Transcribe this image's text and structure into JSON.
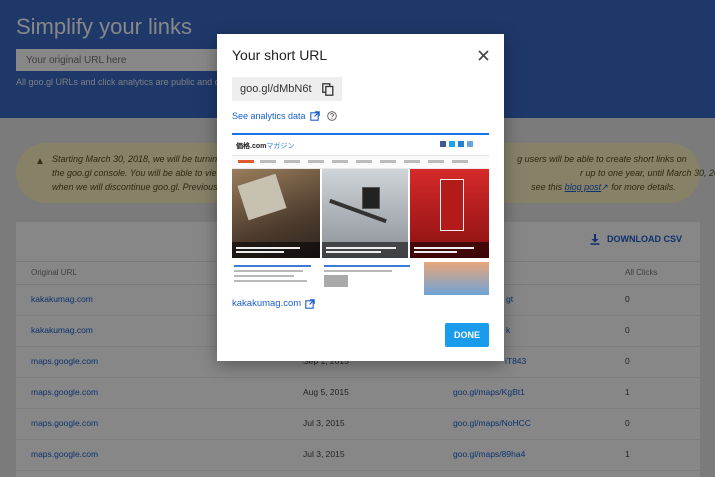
{
  "hero": {
    "title": "Simplify your links",
    "input_placeholder": "Your original URL here",
    "note": "All goo.gl URLs and click analytics are public and c"
  },
  "notice": {
    "line1_left": "Starting March 30, 2018, we will be turnin",
    "line1_right": "g users will be able to create short links on",
    "line2_left": "the goo.gl console. You will be able to view y",
    "line2_right": "r up to one year, until March 30, 2019,",
    "line3_left": "when we will discontinue goo.gl. Previously c",
    "line3_pre": "see this",
    "line3_link": "blog post",
    "line3_post": "for more details."
  },
  "table": {
    "download_label": "DOWNLOAD CSV",
    "headers": {
      "original": "Original URL",
      "clicks": "All Clicks"
    },
    "rows": [
      {
        "url": "kakakumag.com",
        "date": "",
        "short": "gt",
        "clicks": "0"
      },
      {
        "url": "kakakumag.com",
        "date": "",
        "short": "k",
        "clicks": "0"
      },
      {
        "url": "maps.google.com",
        "date": "Sep 1, 2015",
        "short": "iT843",
        "clicks": "0"
      },
      {
        "url": "maps.google.com",
        "date": "Aug 5, 2015",
        "short": "goo.gl/maps/KgBt1",
        "clicks": "1"
      },
      {
        "url": "maps.google.com",
        "date": "Jul 3, 2015",
        "short": "goo.gl/maps/NoHCC",
        "clicks": "0"
      },
      {
        "url": "maps.google.com",
        "date": "Jul 3, 2015",
        "short": "goo.gl/maps/89ha4",
        "clicks": "1"
      }
    ]
  },
  "dialog": {
    "title": "Your short URL",
    "short_url": "goo.gl/dMbN6t",
    "analytics_label": "See analytics data",
    "preview_logo_main": "価格.com",
    "preview_logo_sub": "マガジン",
    "preview_domain": "kakakumag.com",
    "done_label": "DONE"
  },
  "colors": {
    "hero_blue": "#3b6bc9",
    "link_blue": "#1a5fd0",
    "done_button": "#1a9cec",
    "notice_yellow": "#fff3c4"
  },
  "icons": [
    "warning-icon",
    "download-icon",
    "close-icon",
    "copy-icon",
    "external-link-icon",
    "help-icon",
    "twitter-icon",
    "facebook-icon",
    "rss-icon"
  ]
}
